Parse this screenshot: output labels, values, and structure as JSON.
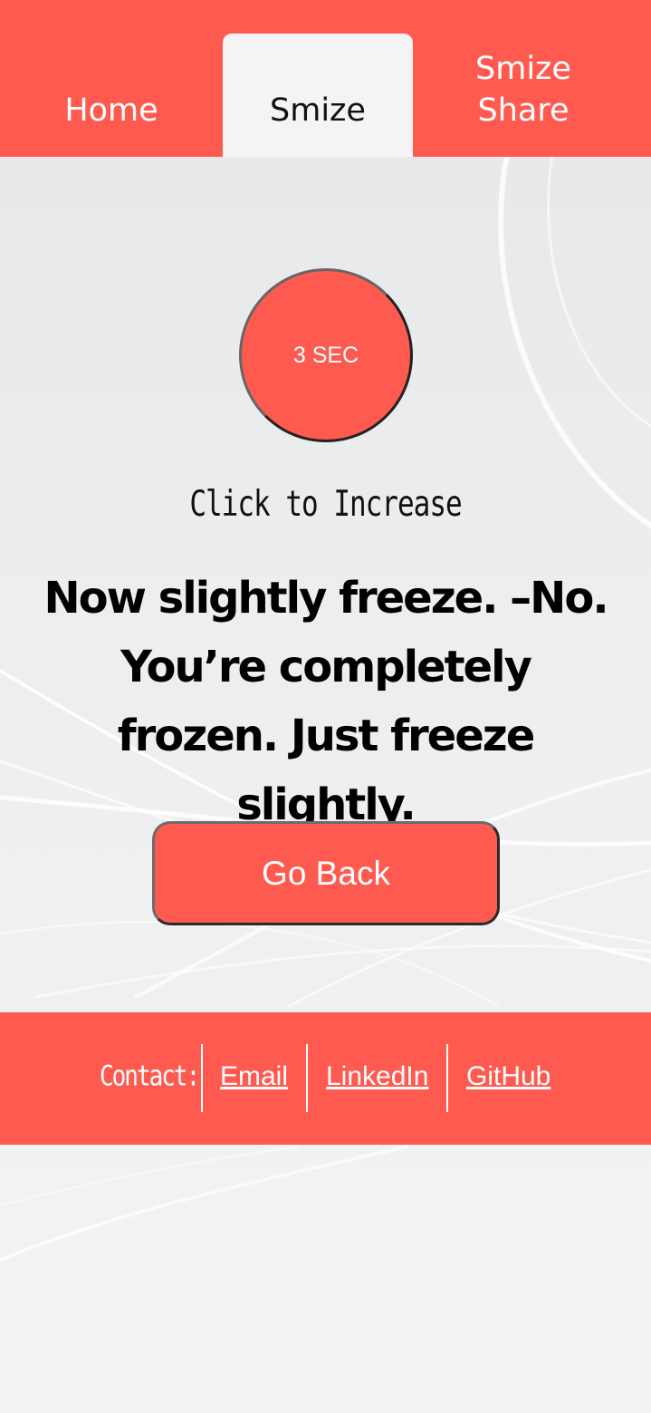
{
  "nav": {
    "tabs": [
      {
        "label": "Home",
        "active": false
      },
      {
        "label": "Smize",
        "active": true
      },
      {
        "label": "Smize\nShare",
        "active": false
      }
    ]
  },
  "timer": {
    "label": "3 SEC",
    "hint": "Click to Increase"
  },
  "message": "Now slightly freeze. –No. You’re completely frozen. Just freeze slightly.",
  "go_back_label": "Go Back",
  "footer": {
    "contact_label": "Contact:",
    "links": [
      "Email",
      "LinkedIn",
      "GitHub"
    ]
  },
  "colors": {
    "accent": "#ff5a50",
    "active_tab": "#f4f4f4",
    "background": "#e9eaec"
  }
}
